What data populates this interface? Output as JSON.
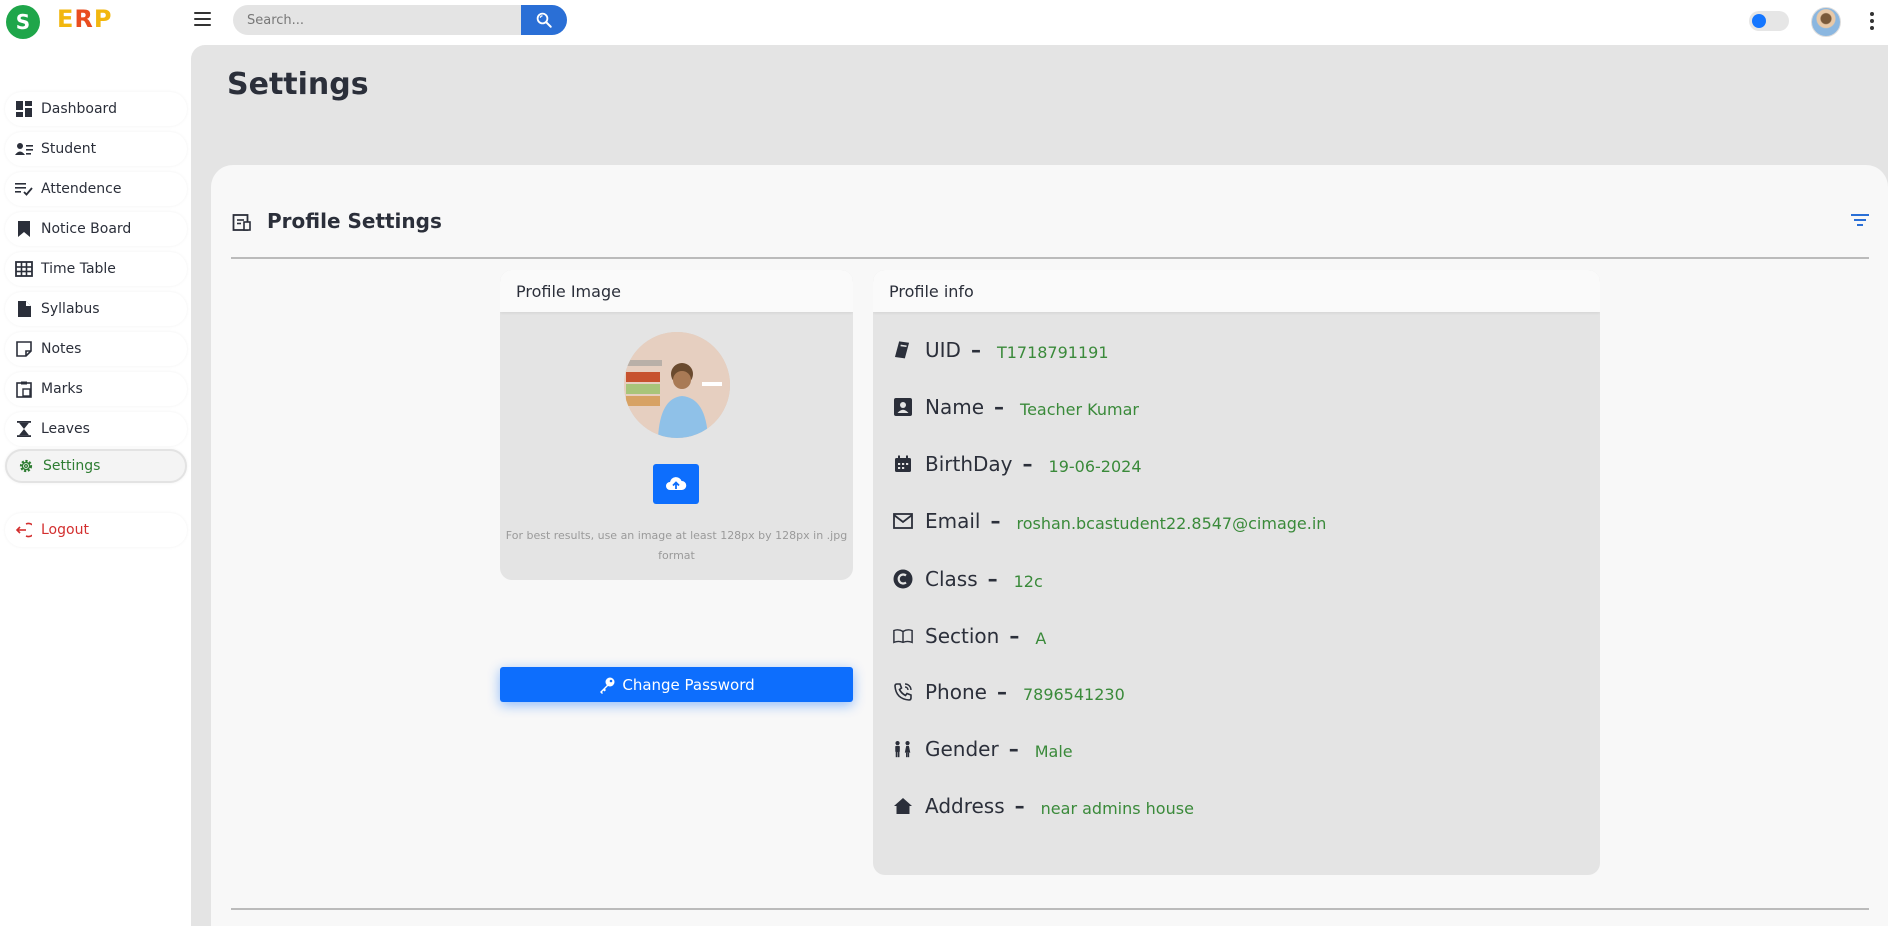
{
  "brand": {
    "logo_letter": "S",
    "name_parts": [
      "E",
      "R",
      "P"
    ]
  },
  "search": {
    "placeholder": "Search..."
  },
  "sidebar": {
    "items": [
      {
        "label": "Dashboard",
        "icon": "dashboard-icon"
      },
      {
        "label": "Student",
        "icon": "student-icon"
      },
      {
        "label": "Attendence",
        "icon": "attendance-icon"
      },
      {
        "label": "Notice Board",
        "icon": "bookmark-icon"
      },
      {
        "label": "Time Table",
        "icon": "table-icon"
      },
      {
        "label": "Syllabus",
        "icon": "document-icon"
      },
      {
        "label": "Notes",
        "icon": "note-icon"
      },
      {
        "label": "Marks",
        "icon": "clipboard-icon"
      },
      {
        "label": "Leaves",
        "icon": "hourglass-icon"
      },
      {
        "label": "Settings",
        "icon": "gear-icon",
        "active": true
      }
    ],
    "logout": {
      "label": "Logout",
      "icon": "logout-icon"
    }
  },
  "page": {
    "title": "Settings"
  },
  "card": {
    "title": "Profile Settings"
  },
  "profile_image": {
    "title": "Profile Image",
    "hint": "For best results, use an image at least 128px by 128px in .jpg format"
  },
  "change_password": {
    "label": "Change Password"
  },
  "profile_info": {
    "title": "Profile info",
    "rows": [
      {
        "label": "UID",
        "value": "T1718791191",
        "icon": "id-tag-icon"
      },
      {
        "label": "Name",
        "value": "Teacher Kumar",
        "icon": "person-badge-icon"
      },
      {
        "label": "BirthDay",
        "value": "19-06-2024",
        "icon": "calendar-icon"
      },
      {
        "label": "Email",
        "value": "roshan.bcastudent22.8547@cimage.in",
        "icon": "mail-icon"
      },
      {
        "label": "Class",
        "value": "12c",
        "icon": "c-circle-icon"
      },
      {
        "label": "Section",
        "value": "A",
        "icon": "book-icon"
      },
      {
        "label": "Phone",
        "value": "7896541230",
        "icon": "phone-icon"
      },
      {
        "label": "Gender",
        "value": "Male",
        "icon": "gender-icon"
      },
      {
        "label": "Address",
        "value": "near admins house",
        "icon": "home-icon"
      }
    ]
  },
  "colors": {
    "accent": "#0d6efd",
    "value_green": "#3a8a3a",
    "logout_red": "#d32f2f",
    "active_green": "#2e7d32"
  }
}
